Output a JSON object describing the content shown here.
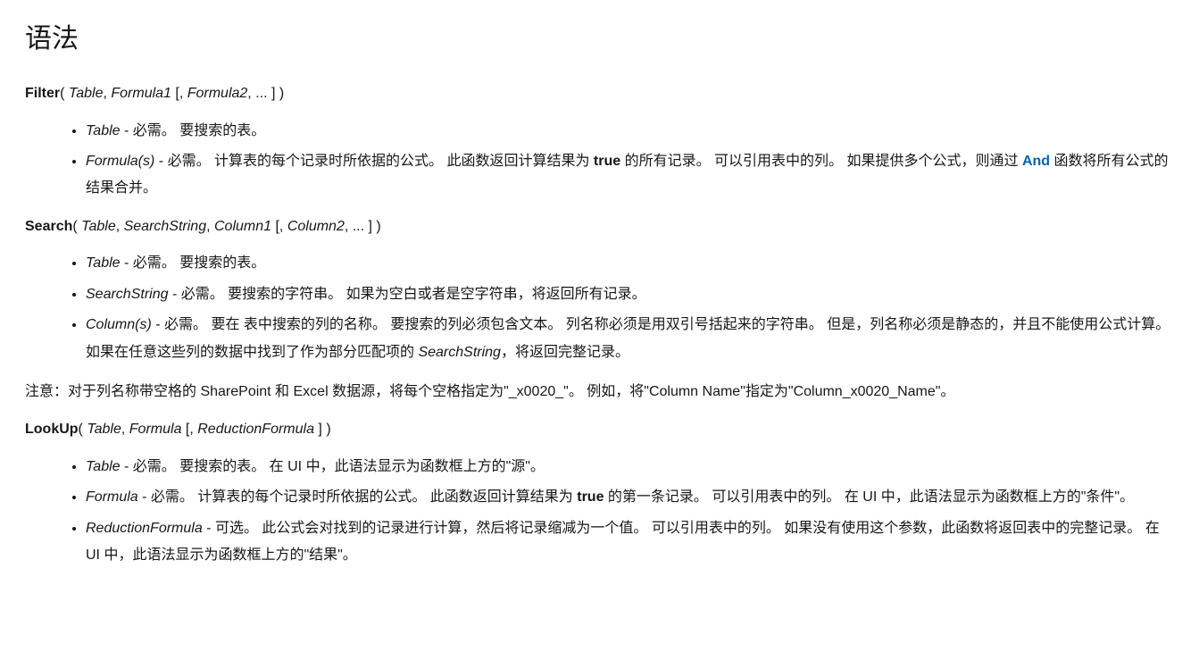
{
  "title": "语法",
  "filter": {
    "fn": "Filter",
    "sig_prefix": "( ",
    "arg1": "Table",
    "sep1": ", ",
    "arg2": "Formula1",
    "optOpen": " [, ",
    "arg3": "Formula2",
    "optRest": ", ... ] )",
    "params": {
      "table": {
        "name": "Table",
        "desc": " - 必需。 要搜索的表。"
      },
      "formulas": {
        "name": "Formula(s)",
        "desc_pre": " - 必需。 计算表的每个记录时所依据的公式。 此函数返回计算结果为 ",
        "bold_true": "true",
        "desc_mid": " 的所有记录。 可以引用表中的列。 如果提供多个公式，则通过 ",
        "link_and": "And",
        "desc_post": " 函数将所有公式的结果合并。"
      }
    }
  },
  "search": {
    "fn": "Search",
    "sig_prefix": "( ",
    "arg1": "Table",
    "sep1": ", ",
    "arg2": "SearchString",
    "sep2": ", ",
    "arg3": "Column1",
    "optOpen": " [, ",
    "arg4": "Column2",
    "optRest": ", ... ] )",
    "params": {
      "table": {
        "name": "Table",
        "desc": " - 必需。 要搜索的表。"
      },
      "searchstring": {
        "name": "SearchString",
        "desc": " - 必需。 要搜索的字符串。 如果为空白或者是空字符串，将返回所有记录。"
      },
      "columns": {
        "name": "Column(s)",
        "desc_pre": " - 必需。 要在 表中搜索的列的名称。 要搜索的列必须包含文本。 列名称必须是用双引号括起来的字符串。 但是，列名称必须是静态的，并且不能使用公式计算。 如果在任意这些列的数据中找到了作为部分匹配项的 ",
        "ital_ss": "SearchString",
        "desc_post": "，将返回完整记录。"
      }
    }
  },
  "note": "注意：对于列名称带空格的 SharePoint 和 Excel 数据源，将每个空格指定为\"_x0020_\"。 例如，将\"Column Name\"指定为\"Column_x0020_Name\"。",
  "lookup": {
    "fn": "LookUp",
    "sig_prefix": "( ",
    "arg1": "Table",
    "sep1": ", ",
    "arg2": "Formula",
    "optOpen": " [, ",
    "arg3": "ReductionFormula",
    "optRest": " ] )",
    "params": {
      "table": {
        "name": "Table",
        "desc": " - 必需。 要搜索的表。 在 UI 中，此语法显示为函数框上方的\"源\"。"
      },
      "formula": {
        "name": "Formula",
        "desc_pre": " - 必需。 计算表的每个记录时所依据的公式。 此函数返回计算结果为 ",
        "bold_true": "true",
        "desc_post": " 的第一条记录。 可以引用表中的列。 在 UI 中，此语法显示为函数框上方的\"条件\"。"
      },
      "reduction": {
        "name": "ReductionFormula",
        "desc": " - 可选。 此公式会对找到的记录进行计算，然后将记录缩减为一个值。 可以引用表中的列。 如果没有使用这个参数，此函数将返回表中的完整记录。 在 UI 中，此语法显示为函数框上方的\"结果\"。"
      }
    }
  }
}
